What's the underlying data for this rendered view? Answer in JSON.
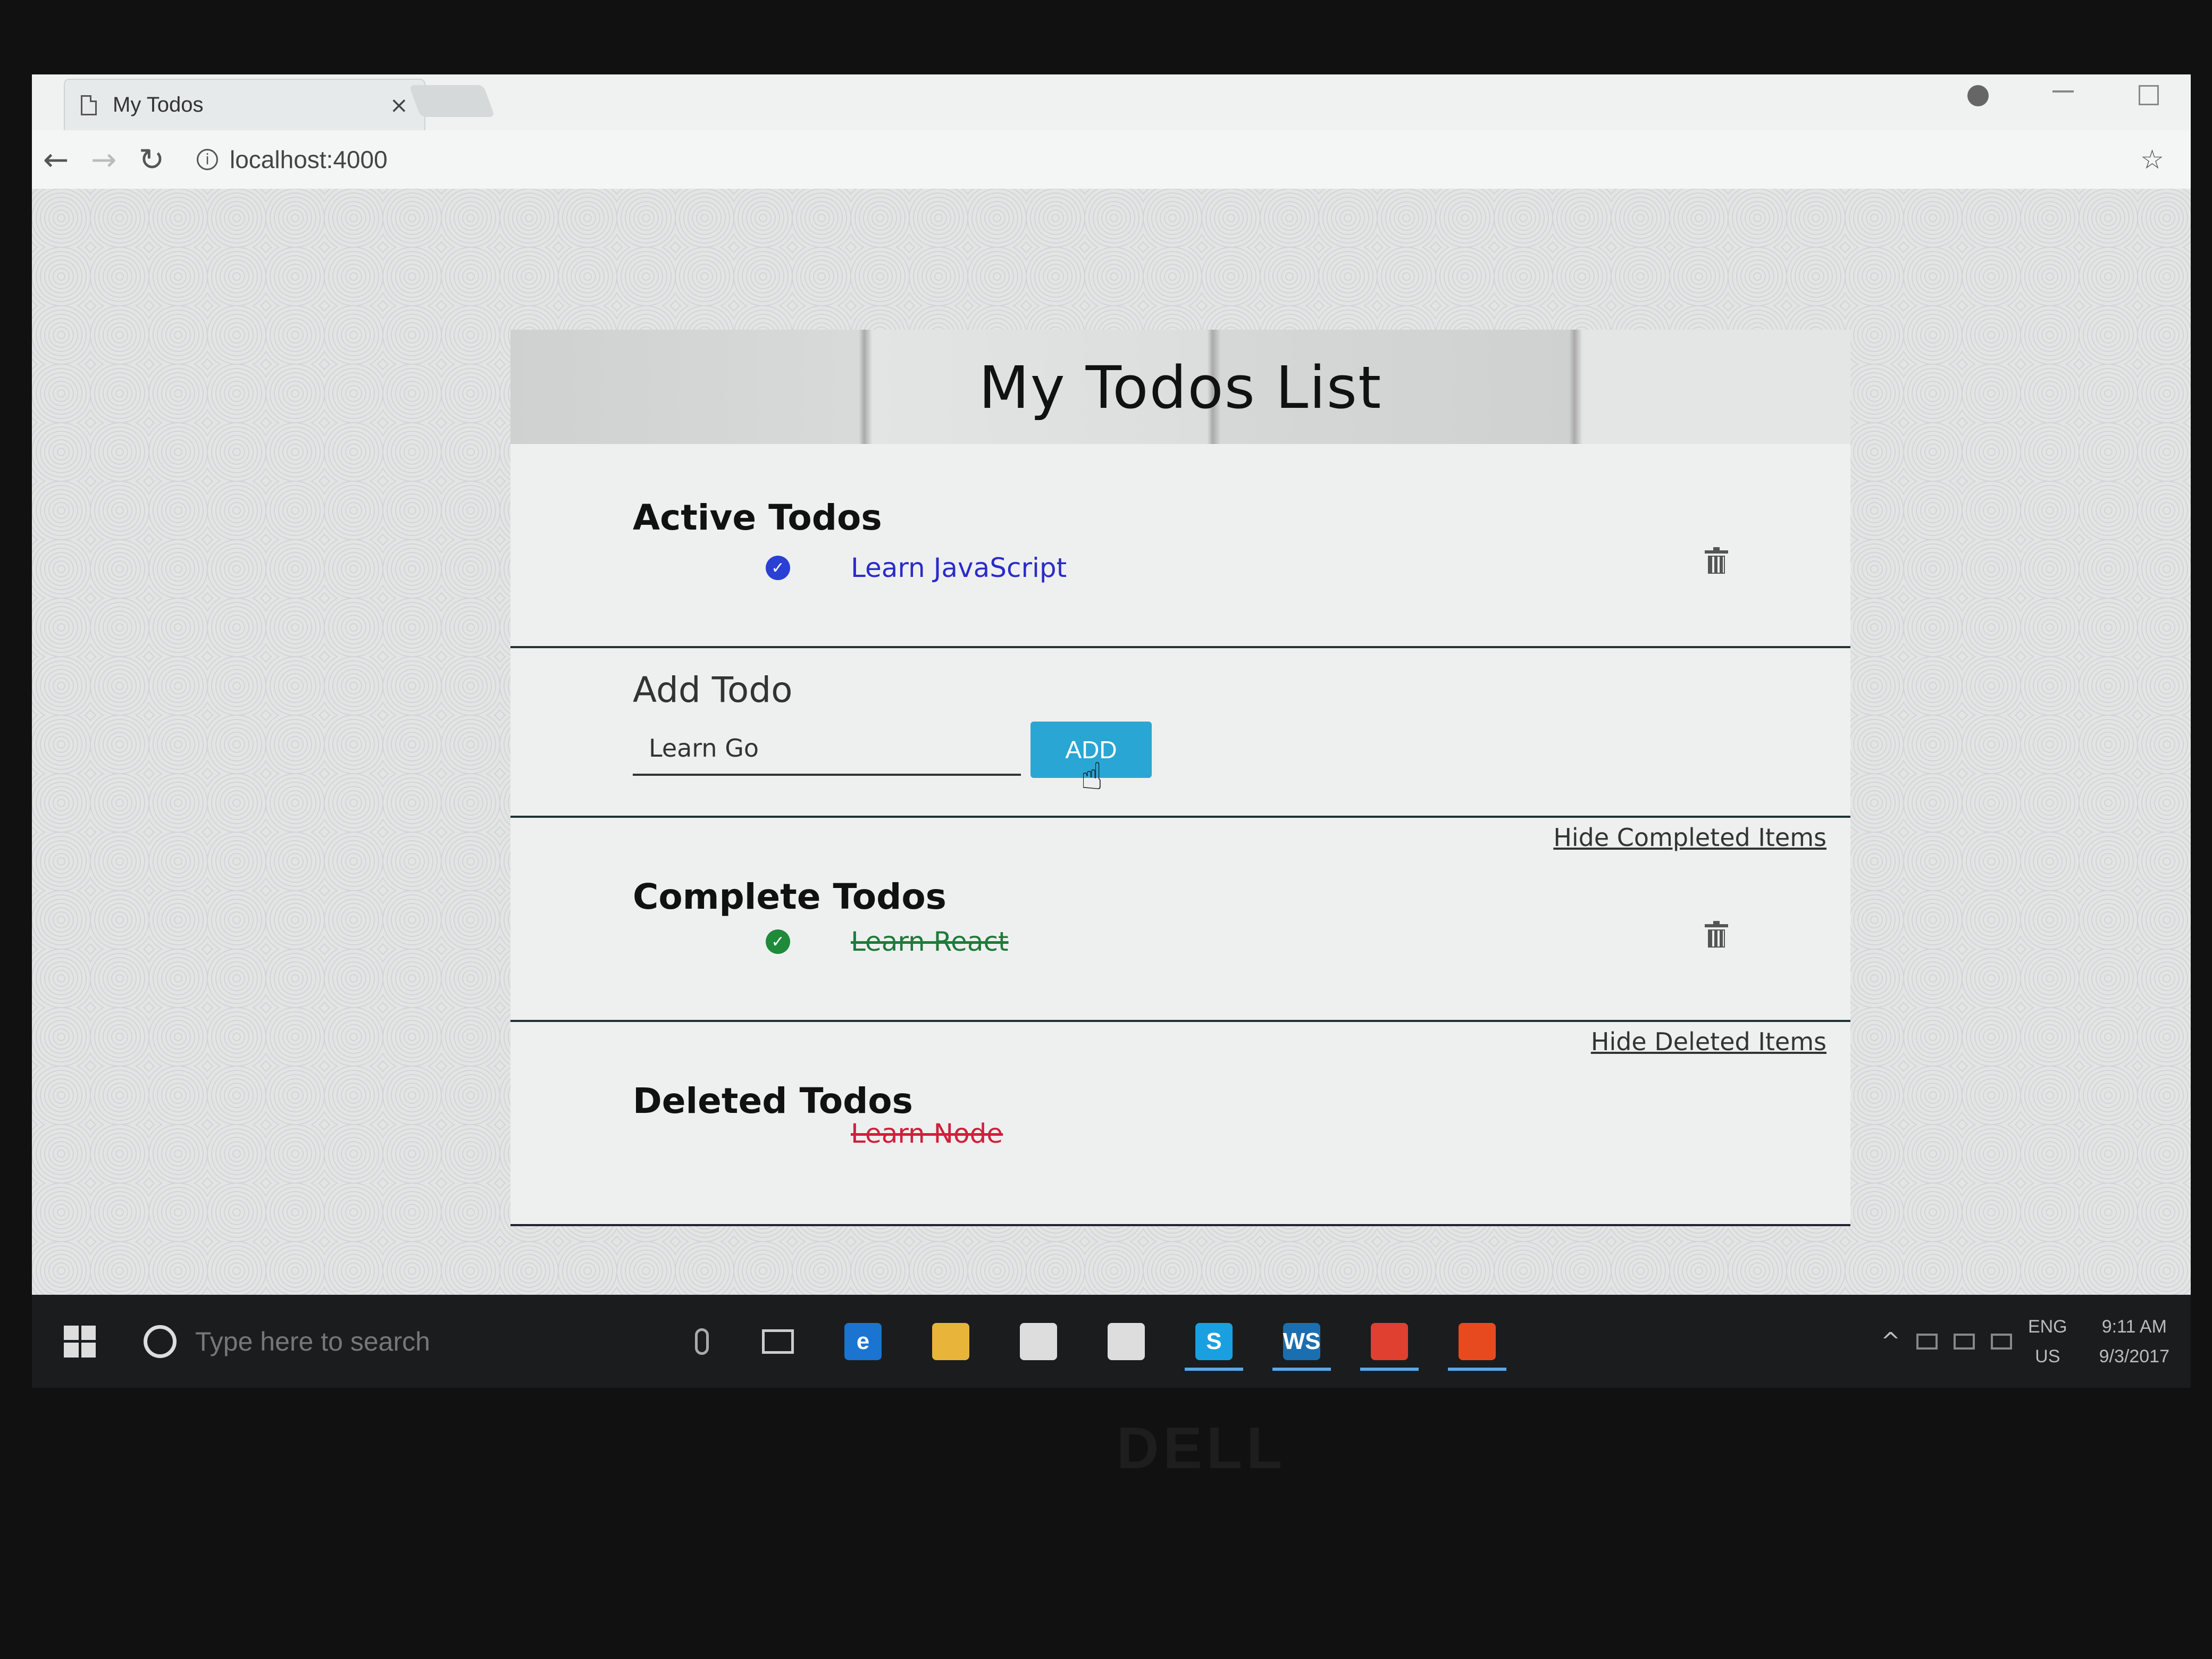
{
  "browser": {
    "tab_title": "My Todos",
    "tab_close": "×",
    "url": "localhost:4000",
    "back": "←",
    "forward": "→",
    "reload": "↻",
    "star": "☆",
    "info": "i"
  },
  "app": {
    "title": "My Todos List",
    "active": {
      "heading": "Active Todos",
      "items": [
        {
          "text": "Learn JavaScript",
          "color": "#2b2bc8",
          "check_color": "#2a3fd4"
        }
      ]
    },
    "add": {
      "heading": "Add Todo",
      "input_value": "Learn Go",
      "button_label": "ADD",
      "button_color": "#2aa6d4"
    },
    "complete": {
      "toggle_label": "Hide Completed Items",
      "heading": "Complete Todos",
      "items": [
        {
          "text": "Learn React",
          "color": "#1f7a3a",
          "check_color": "#1f8a3a"
        }
      ]
    },
    "deleted": {
      "toggle_label": "Hide Deleted Items",
      "heading": "Deleted Todos",
      "items": [
        {
          "text": "Learn Node",
          "color": "#d0203a"
        }
      ]
    }
  },
  "taskbar": {
    "search_placeholder": "Type here to search",
    "apps": [
      {
        "name": "edge-icon",
        "glyph": "e",
        "color": "#1a74d0"
      },
      {
        "name": "file-explorer-icon",
        "glyph": "",
        "color": "#e8b43a"
      },
      {
        "name": "store-icon",
        "glyph": "",
        "color": "#dddddd"
      },
      {
        "name": "mail-icon",
        "glyph": "",
        "color": "#dddddd"
      },
      {
        "name": "skype-icon",
        "glyph": "S",
        "color": "#1aa0e0"
      },
      {
        "name": "webstorm-icon",
        "glyph": "WS",
        "color": "#1b6fb0"
      },
      {
        "name": "chrome-icon",
        "glyph": "",
        "color": "#e04030"
      },
      {
        "name": "paint-icon",
        "glyph": "",
        "color": "#e84a20"
      }
    ],
    "tray": {
      "lang_line1": "ENG",
      "lang_line2": "US",
      "time": "9:11 AM",
      "date": "9/3/2017"
    }
  },
  "bezel": {
    "brand": "DELL"
  }
}
